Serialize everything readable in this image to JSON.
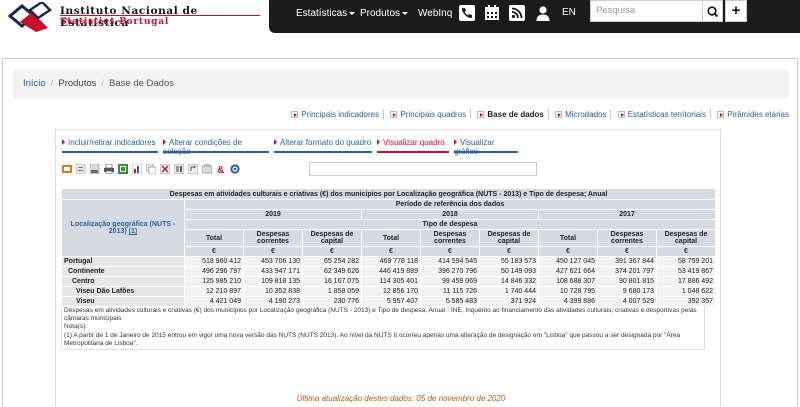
{
  "header": {
    "logo_line1": "Instituto Nacional de Estatística",
    "logo_line2": "Statistics Portugal",
    "nav": [
      {
        "label": "Estatísticas",
        "dropdown": true
      },
      {
        "label": "Produtos",
        "dropdown": true
      },
      {
        "label": "WebInq",
        "dropdown": false
      }
    ],
    "icons": [
      "phone-icon",
      "calendar-icon",
      "rss-icon",
      "user-icon"
    ],
    "lang": "EN",
    "search_placeholder": "Pesquisa"
  },
  "breadcrumb": [
    {
      "label": "Início",
      "link": true
    },
    {
      "label": "Produtos",
      "link": false
    },
    {
      "label": "Base de Dados",
      "link": false
    }
  ],
  "subnav": [
    {
      "label": "Principais indicadores",
      "active": false
    },
    {
      "label": "Principais quadros",
      "active": false
    },
    {
      "label": "Base de dados",
      "active": true
    },
    {
      "label": "Microdados",
      "active": false
    },
    {
      "label": "Estatísticas territoriais",
      "active": false
    },
    {
      "label": "Pirâmides etárias",
      "active": false
    }
  ],
  "tabs": [
    {
      "label": "Incluir/retirar indicadores",
      "active": false
    },
    {
      "label": "Alterar condições de seleção",
      "active": false
    },
    {
      "label": "Alterar formato do quadro",
      "active": false
    },
    {
      "label": "Visualizar quadro",
      "active": true
    },
    {
      "label": "Visualizar gráfico",
      "active": false
    }
  ],
  "toolbar_icons": [
    "excel-icon",
    "csv-icon",
    "pdf-icon",
    "print-icon",
    "export-icon",
    "chart-icon",
    "copy-icon",
    "delete-icon",
    "hide-icon",
    "rotate-icon",
    "metadata-icon",
    "link-icon",
    "help-icon"
  ],
  "table": {
    "title": "Despesas em atividades culturais e criativas (€) dos municípios por Localização geográfica (NUTS - 2013) e Tipo de despesa; Anual",
    "period_header": "Período de referência dos dados",
    "stub_header": "Localização geográfica (NUTS - 2013)",
    "stub_note": "(1)",
    "years": [
      "2019",
      "2018",
      "2017"
    ],
    "type_header": "Tipo de despesa",
    "columns": [
      "Total",
      "Despesas correntes",
      "Despesas de capital"
    ],
    "unit": "€",
    "rows": [
      {
        "label": "Portugal",
        "level": 0,
        "values": [
          "518 960 412",
          "453 706 130",
          "65 254 282",
          "469 778 118",
          "414 594 545",
          "55 183 573",
          "450 127 045",
          "391 367 844",
          "58 759 201"
        ]
      },
      {
        "label": "Continente",
        "level": 1,
        "values": [
          "496 296 797",
          "433 947 171",
          "62 349 626",
          "446 419 889",
          "396 270 796",
          "50 149 093",
          "427 621 664",
          "374 201 797",
          "53 419 867"
        ]
      },
      {
        "label": "Centro",
        "level": 2,
        "values": [
          "125 985 210",
          "109 818 135",
          "16 167 075",
          "114 305 401",
          "99 459 069",
          "14 846 332",
          "108 688 307",
          "90 801 815",
          "17 886 492"
        ]
      },
      {
        "label": "Viseu Dão Lafões",
        "level": 3,
        "values": [
          "12 210 897",
          "10 352 838",
          "1 858 059",
          "12 856 170",
          "11 115 726",
          "1 740 444",
          "10 728 795",
          "9 680 173",
          "1 048 622"
        ]
      },
      {
        "label": "Viseu",
        "level": 3,
        "values": [
          "4 421 049",
          "4 190 273",
          "230 776",
          "5 957 407",
          "5 585 483",
          "371 924",
          "4 399 886",
          "4 007 529",
          "392 357"
        ]
      }
    ],
    "footnote_1": "Despesas em atividades culturais e criativas (€) dos municípios por Localização geográfica (NUTS - 2013) e Tipo de despesa; Anual - INE, Inquérito ao financiamento das atividades culturais, criativas e desportivas pelas câmaras municipais",
    "notes_title": "Nota(s):",
    "note_1": "(1) A partir de 1 de Janeiro de 2015 entrou em vigor uma nova versão das NUTS (NUTS 2013). Ao nível da NUTS II ocorreu apenas uma alteração de designação em \"Lisboa\" que passou a ser designada por \"Área Metropolitana de Lisboa\"."
  },
  "last_update": "Última atualização destes dados: 05 de novembro de 2020"
}
